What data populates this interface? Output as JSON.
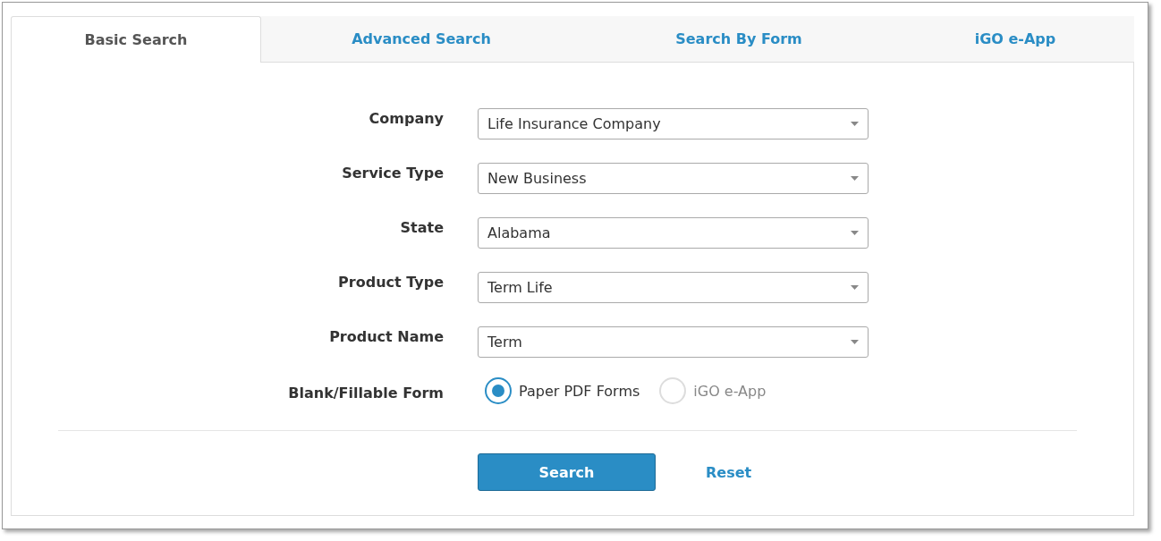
{
  "tabs": [
    {
      "label": "Basic Search",
      "selected": true
    },
    {
      "label": "Advanced Search",
      "selected": false
    },
    {
      "label": "Search By Form",
      "selected": false
    },
    {
      "label": "iGO e-App",
      "selected": false
    }
  ],
  "form": {
    "fields": [
      {
        "label": "Company",
        "value": "Life Insurance Company"
      },
      {
        "label": "Service Type",
        "value": "New Business"
      },
      {
        "label": "State",
        "value": "Alabama"
      },
      {
        "label": "Product Type",
        "value": "Term Life"
      },
      {
        "label": "Product Name",
        "value": "Term"
      }
    ],
    "blank_fillable": {
      "label": "Blank/Fillable Form",
      "options": [
        {
          "label": "Paper PDF Forms",
          "selected": true
        },
        {
          "label": "iGO e-App",
          "selected": false
        }
      ]
    }
  },
  "buttons": {
    "search": "Search",
    "reset": "Reset"
  }
}
